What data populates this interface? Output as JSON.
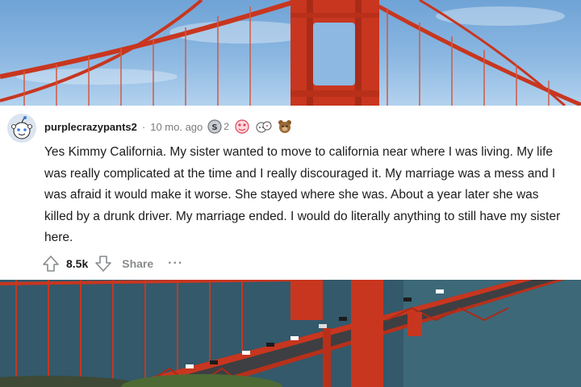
{
  "comment": {
    "username": "purplecrazypants2",
    "separator": "·",
    "age": "10 mo. ago",
    "awards": [
      {
        "icon": "silver-award-icon",
        "count": "2"
      },
      {
        "icon": "heart-eyes-award-icon",
        "count": ""
      },
      {
        "icon": "wholesome-award-icon",
        "count": ""
      },
      {
        "icon": "bear-award-icon",
        "count": ""
      }
    ],
    "body": "Yes Kimmy California. My sister wanted to move to california near where I was living. My life was really complicated at the time and I really discouraged it. My marriage was a mess and I was afraid it would make it worse. She stayed where she was. About a year later she was killed by a drunk driver. My marriage ended. I would do literally anything to still have my sister here.",
    "votes": "8.5k",
    "share_label": "Share",
    "more_label": "···"
  },
  "colors": {
    "card_bg": "#ffffff",
    "text": "#1c1c1c",
    "meta": "#7c7c7c",
    "bridge_red": "#c8361f"
  }
}
